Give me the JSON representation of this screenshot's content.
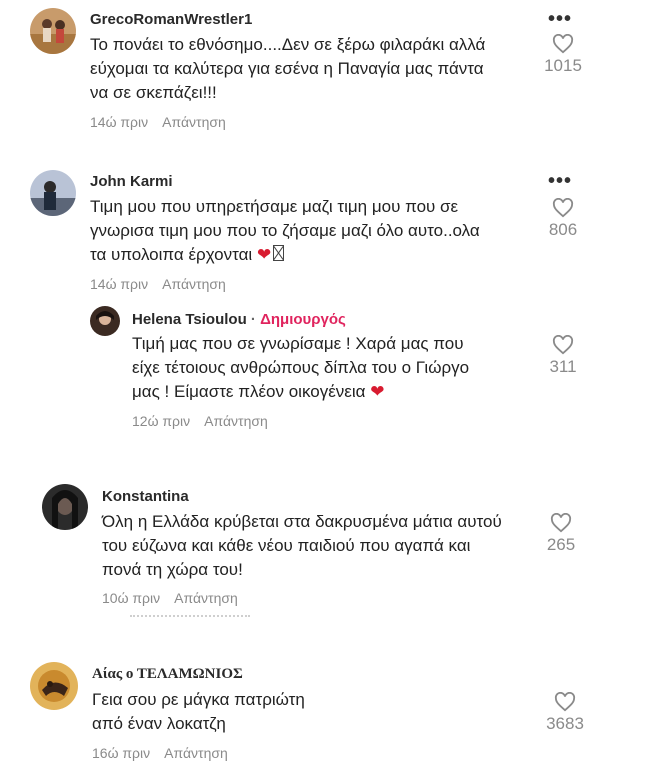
{
  "comments": [
    {
      "username": "GrecoRomanWrestler1",
      "lines": [
        "Το πονάει το εθνόσημο....Δεν σε ξέρω φιλαράκι αλλά",
        "εύχομαι τα καλύτερα για εσένα η Παναγία μας πάντα",
        "να σε σκεπάζει!!!"
      ],
      "time": "14ώ πριν",
      "reply_label": "Απάντηση",
      "likes": "1015",
      "avatar_color": "#c89b6b"
    },
    {
      "username": "John Karmi",
      "lines": [
        "Τιμη μου που υπηρετήσαμε μαζι τιμη μου που σε",
        "γνωρισα τιμη μου που το ζήσαμε μαζι όλο αυτο..ολα",
        "τα υπολοιπα έρχονται"
      ],
      "time": "14ώ πριν",
      "reply_label": "Απάντηση",
      "likes": "806",
      "avatar_color": "#7d8aa3"
    },
    {
      "username": "Helena Tsioulou",
      "separator": "·",
      "creator_label": "Δημιουργός",
      "lines": [
        "Τιμή μας που σε γνωρίσαμε ! Χαρά μας που",
        "είχε τέτοιους ανθρώπους δίπλα του ο Γιώργο",
        "μας ! Είμαστε πλέον οικογένεια"
      ],
      "time": "12ώ πριν",
      "reply_label": "Απάντηση",
      "likes": "311",
      "avatar_color": "#3b2a22"
    },
    {
      "username": "Konstantina",
      "lines": [
        "Όλη η Ελλάδα κρύβεται στα δακρυσμένα μάτια αυτού",
        "του εύζωνα και κάθε νέου παιδιού που αγαπά και",
        "πονά τη χώρα του!"
      ],
      "time": "10ώ πριν",
      "reply_label": "Απάντηση",
      "likes": "265",
      "avatar_color": "#2b2b2b"
    },
    {
      "username": "Αίας ο ΤΕΛΑΜΩΝΙΟΣ",
      "lines": [
        "Γεια σου ρε μάγκα πατριώτη",
        "από έναν λοκατζη"
      ],
      "time": "16ώ πριν",
      "reply_label": "Απάντηση",
      "likes": "3683",
      "avatar_color": "#d4a24c"
    }
  ],
  "emoji": {
    "heart": "❤",
    "more": "•••"
  },
  "colors": {
    "creator_accent": "#e0245e",
    "meta_gray": "#8a8a8a"
  },
  "icons": [
    "heart-outline-icon",
    "more-horizontal-icon",
    "red-heart-emoji"
  ]
}
